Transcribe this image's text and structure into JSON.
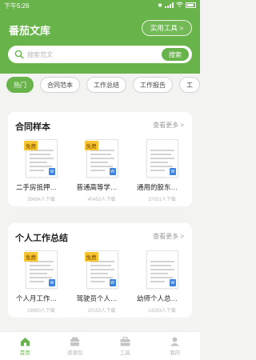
{
  "status": {
    "time": "下午5:26"
  },
  "header": {
    "title": "番茄文库",
    "tools_label": "实用工具 >"
  },
  "search": {
    "placeholder": "搜索范文",
    "button": "搜索"
  },
  "tabs": [
    {
      "label": "热门",
      "active": true
    },
    {
      "label": "合同范本"
    },
    {
      "label": "工作总结"
    },
    {
      "label": "工作报告"
    },
    {
      "label": "工"
    }
  ],
  "sections": [
    {
      "title": "合同样本",
      "more": "查看更多 >",
      "items": [
        {
          "title": "二手房抵押…",
          "downloads": "39694人下载",
          "badge": "免费"
        },
        {
          "title": "普通高等学…",
          "downloads": "40453人下载",
          "badge": "免费"
        },
        {
          "title": "通用的股东…",
          "downloads": "37031人下载",
          "badge": ""
        }
      ]
    },
    {
      "title": "个人工作总结",
      "more": "查看更多 >",
      "items": [
        {
          "title": "个人月工作…",
          "downloads": "18980人下载",
          "badge": "免费"
        },
        {
          "title": "驾驶员个人…",
          "downloads": "20153人下载",
          "badge": "免费"
        },
        {
          "title": "幼师个人总…",
          "downloads": "14293人下载",
          "badge": ""
        }
      ]
    }
  ],
  "nav": [
    {
      "label": "首页",
      "icon": "home-icon",
      "active": true
    },
    {
      "label": "资源包",
      "icon": "package-icon"
    },
    {
      "label": "工具",
      "icon": "toolbox-icon"
    },
    {
      "label": "我的",
      "icon": "profile-icon"
    }
  ],
  "colors": {
    "primary": "#68b34a",
    "badge": "#f7c531",
    "word": "#3c84e0"
  }
}
